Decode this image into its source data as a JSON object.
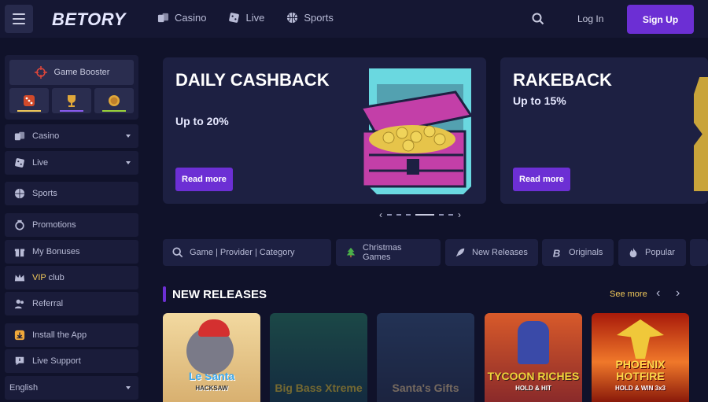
{
  "header": {
    "logo": "BETORY",
    "nav": [
      "Casino",
      "Live",
      "Sports"
    ],
    "login": "Log In",
    "signup": "Sign Up"
  },
  "sidebar": {
    "game_booster": "Game Booster",
    "items": [
      "Casino",
      "Live",
      "Sports",
      "Promotions",
      "My Bonuses",
      "club",
      "Referral",
      "Install the App",
      "Live Support",
      "English"
    ],
    "vip_prefix": "VIP"
  },
  "banners": [
    {
      "title": "DAILY CASHBACK",
      "subtitle": "Up to 20%",
      "button": "Read more"
    },
    {
      "title": "RAKEBACK",
      "subtitle": "Up to 15%",
      "button": "Read more"
    }
  ],
  "search": {
    "placeholder": "Game | Provider | Category"
  },
  "categories": [
    "Christmas Games",
    "New Releases",
    "Originals",
    "Popular"
  ],
  "section": {
    "title": "NEW RELEASES",
    "see_more": "See more"
  },
  "games": [
    {
      "name": "Le Santa",
      "provider": "HACKSAW"
    },
    {
      "name": "Big Bass Xtreme",
      "provider": ""
    },
    {
      "name": "Santa's Gifts",
      "provider": ""
    },
    {
      "name": "TYCOON RICHES",
      "provider": "HOLD & HIT"
    },
    {
      "name": "PHOENIX HOTFIRE",
      "provider": "HOLD & WIN 3x3"
    }
  ],
  "colors": {
    "accent": "#6c2fd4",
    "gold": "#f0c85a",
    "bg": "#10122a"
  }
}
